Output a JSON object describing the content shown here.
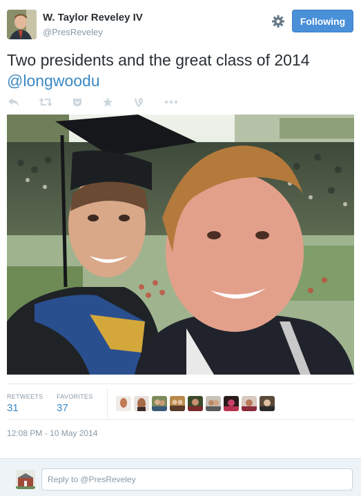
{
  "header": {
    "name": "W. Taylor Reveley IV",
    "handle": "@PresReveley",
    "follow_label": "Following"
  },
  "tweet": {
    "text": "Two presidents and the great class of 2014",
    "mention": "@longwoodu"
  },
  "actions": [
    "reply-icon",
    "retweet-icon",
    "pocket-icon",
    "favorite-icon",
    "vine-icon",
    "more-icon"
  ],
  "stats": {
    "retweets_label": "RETWEETS",
    "retweets_value": "31",
    "favorites_label": "FAVORITES",
    "favorites_value": "37"
  },
  "timestamp": "12:08 PM - 10 May 2014",
  "reply": {
    "placeholder": "Reply to @PresReveley"
  },
  "colors": {
    "accent": "#3b88c3",
    "follow_button": "#4a90d9"
  }
}
